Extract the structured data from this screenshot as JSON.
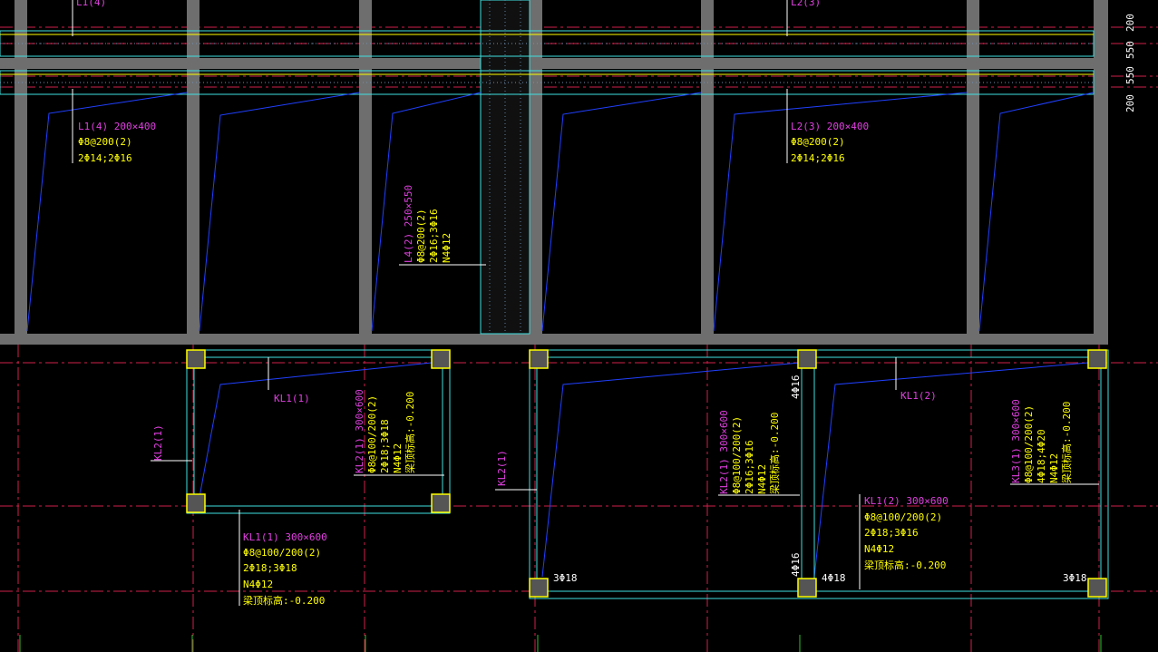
{
  "colors": {
    "background": "#000000",
    "wall": "#6e6e6e",
    "cyan": "#40e0e0",
    "magenta": "#e040e0",
    "yellow": "#ffff00",
    "blue": "#2040ff",
    "axis_red": "#d0204a",
    "axis_green": "#30c030"
  },
  "labels": {
    "top_left_cut": "L1(4)",
    "top_mid_cut": "L2(3)",
    "l1_name": "L1(4) 200×400",
    "l1_stirrup": "Φ8@200(2)",
    "l1_bars": "2Φ14;2Φ16",
    "l2_name": "L2(3) 200×400",
    "l2_stirrup": "Φ8@200(2)",
    "l2_bars": "2Φ14;2Φ16",
    "l4_name": "L4(2) 250×550",
    "l4_stirrup": "Φ8@200(2)",
    "l4_bars": "2Φ16;3Φ16",
    "l4_waist": "N4Φ12",
    "kl1_1_tag": "KL1(1)",
    "kl1_2_tag": "KL1(2)",
    "kl2_left_tag": "KL2(1)",
    "kl2_mid_tag": "KL2(1)",
    "kl1_1_name": "KL1(1) 300×600",
    "kl1_1_stirrup": "Φ8@100/200(2)",
    "kl1_1_bars": "2Φ18;3Φ18",
    "kl1_1_waist": "N4Φ12",
    "kl1_1_elev": "梁顶标高:-0.200",
    "kl2_name": "KL2(1) 300×600",
    "kl2_stirrup": "Φ8@100/200(2)",
    "kl2_bars": "2Φ18;3Φ18",
    "kl2_waist": "N4Φ12",
    "kl2_elev": "梁顶标高:-0.200",
    "kl2b_name": "KL2(1) 300×600",
    "kl2b_stirrup": "Φ8@100/200(2)",
    "kl2b_bars": "2Φ16;3Φ16",
    "kl2b_waist": "N4Φ12",
    "kl2b_elev": "梁顶标高:-0.200",
    "kl3_name": "KL3(1) 300×600",
    "kl3_stirrup": "Φ8@100/200(2)",
    "kl3_bars": "4Φ18;4Φ20",
    "kl3_waist": "N4Φ12",
    "kl3_elev": "梁顶标高:-0.200",
    "kl1_2_name": "KL1(2) 300×600",
    "kl1_2_stirrup": "Φ8@100/200(2)",
    "kl1_2_bars": "2Φ18;3Φ16",
    "kl1_2_waist": "N4Φ12",
    "kl1_2_elev": "梁顶标高:-0.200",
    "bot_3phi18_a": "3Φ18",
    "bot_4phi18": "4Φ18",
    "bot_3phi18_b": "3Φ18",
    "mid_4phi16_top": "4Φ16",
    "mid_4phi16_bot": "4Φ16"
  },
  "dimensions": [
    "200",
    "550",
    "550",
    "200"
  ]
}
